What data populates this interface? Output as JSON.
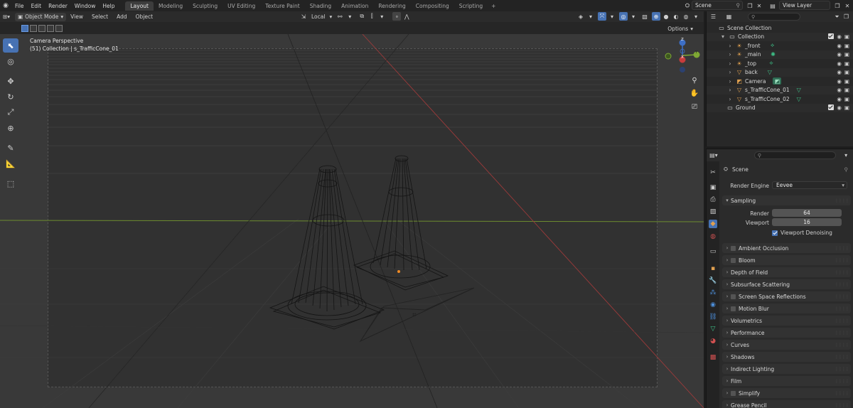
{
  "topbar": {
    "menus": [
      "File",
      "Edit",
      "Render",
      "Window",
      "Help"
    ],
    "workspaces": [
      "Layout",
      "Modeling",
      "Sculpting",
      "UV Editing",
      "Texture Paint",
      "Shading",
      "Animation",
      "Rendering",
      "Compositing",
      "Scripting"
    ],
    "active_workspace": "Layout",
    "add_workspace": "+",
    "scene": "Scene",
    "view_layer": "View Layer"
  },
  "viewport_header": {
    "mode": "Object Mode",
    "menus": [
      "View",
      "Select",
      "Add",
      "Object"
    ],
    "transform_orientation": "Local",
    "options": "Options"
  },
  "viewport": {
    "camera_label": "Camera Perspective",
    "collection_label": "(51) Collection | s_TrafficCone_01",
    "gizmo": {
      "z": "Z",
      "y": "Y",
      "x": "X"
    }
  },
  "outliner": {
    "root": "Scene Collection",
    "items": [
      {
        "name": "Collection",
        "level": 1,
        "icon": "collection-icon"
      },
      {
        "name": "_front",
        "level": 2,
        "icon": "light-icon"
      },
      {
        "name": "_main",
        "level": 2,
        "icon": "light-icon"
      },
      {
        "name": "_top",
        "level": 2,
        "icon": "light-icon"
      },
      {
        "name": "back",
        "level": 2,
        "icon": "light-icon"
      },
      {
        "name": "Camera",
        "level": 2,
        "icon": "camera-icon"
      },
      {
        "name": "s_TrafficCone_01",
        "level": 2,
        "icon": "mesh-icon"
      },
      {
        "name": "s_TrafficCone_02",
        "level": 2,
        "icon": "mesh-icon"
      },
      {
        "name": "Ground",
        "level": 1,
        "icon": "collection-icon"
      }
    ]
  },
  "properties": {
    "context": "Scene",
    "render_engine_label": "Render Engine",
    "render_engine": "Eevee",
    "sampling": {
      "title": "Sampling",
      "render_label": "Render",
      "render_value": "64",
      "viewport_label": "Viewport",
      "viewport_value": "16",
      "denoise_label": "Viewport Denoising"
    },
    "panels": [
      {
        "label": "Ambient Occlusion",
        "checkbox": true
      },
      {
        "label": "Bloom",
        "checkbox": true
      },
      {
        "label": "Depth of Field",
        "checkbox": false
      },
      {
        "label": "Subsurface Scattering",
        "checkbox": false
      },
      {
        "label": "Screen Space Reflections",
        "checkbox": true
      },
      {
        "label": "Motion Blur",
        "checkbox": true
      },
      {
        "label": "Volumetrics",
        "checkbox": false
      },
      {
        "label": "Performance",
        "checkbox": false
      },
      {
        "label": "Curves",
        "checkbox": false
      },
      {
        "label": "Shadows",
        "checkbox": false
      },
      {
        "label": "Indirect Lighting",
        "checkbox": false
      },
      {
        "label": "Film",
        "checkbox": false
      },
      {
        "label": "Simplify",
        "checkbox": true
      },
      {
        "label": "Grease Pencil",
        "checkbox": false
      }
    ]
  },
  "colors": {
    "accent": "#4772b3",
    "x_axis": "#c83c3c",
    "y_axis": "#7fa834",
    "z_axis": "#3d6fc7",
    "origin": "#f08a24"
  }
}
